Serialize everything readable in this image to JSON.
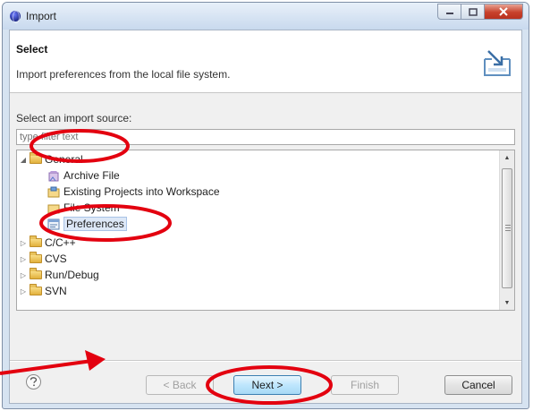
{
  "window": {
    "title": "Import",
    "app_icon": "eclipse-icon",
    "controls": {
      "minimize": "minimize-icon",
      "maximize": "maximize-icon",
      "close": "close-icon"
    }
  },
  "header": {
    "title": "Select",
    "description": "Import preferences from the local file system.",
    "icon": "import-wizard-icon"
  },
  "source": {
    "label": "Select an import source:",
    "filter_placeholder": "type filter text"
  },
  "tree": {
    "items": [
      {
        "label": "General",
        "expanded": true,
        "icon": "folder-icon"
      },
      {
        "label": "Archive File",
        "icon": "archive-file-icon"
      },
      {
        "label": "Existing Projects into Workspace",
        "icon": "existing-projects-icon"
      },
      {
        "label": "File System",
        "icon": "file-system-icon"
      },
      {
        "label": "Preferences",
        "icon": "preferences-icon",
        "selected": true
      },
      {
        "label": "C/C++",
        "expanded": false,
        "icon": "folder-icon"
      },
      {
        "label": "CVS",
        "expanded": false,
        "icon": "folder-icon"
      },
      {
        "label": "Run/Debug",
        "expanded": false,
        "icon": "folder-icon"
      },
      {
        "label": "SVN",
        "expanded": false,
        "icon": "folder-icon"
      }
    ]
  },
  "buttons": {
    "help_icon": "help-icon",
    "back": "< Back",
    "next": "Next >",
    "finish": "Finish",
    "cancel": "Cancel"
  },
  "annotation_color": "#e3000f"
}
